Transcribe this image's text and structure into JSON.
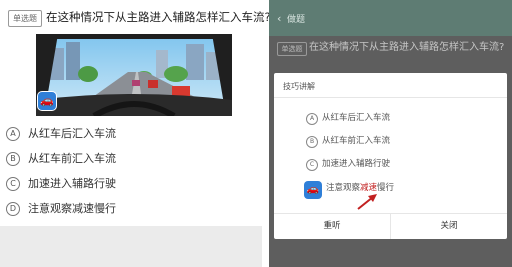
{
  "left": {
    "tag": "单选题",
    "question": "在这种情况下从主路进入辅路怎样汇入车流?",
    "options": [
      {
        "letter": "A",
        "label": "从红车后汇入车流"
      },
      {
        "letter": "B",
        "label": "从红车前汇入车流"
      },
      {
        "letter": "C",
        "label": "加速进入辅路行驶"
      },
      {
        "letter": "D",
        "label": "注意观察减速慢行"
      }
    ]
  },
  "right": {
    "header_title": "做题",
    "tag": "单选题",
    "question": "在这种情况下从主路进入辅路怎样汇入车流?",
    "dialog": {
      "title": "技巧讲解",
      "options": [
        {
          "letter": "A",
          "label": "从红车后汇入车流"
        },
        {
          "letter": "B",
          "label": "从红车前汇入车流"
        },
        {
          "letter": "C",
          "label": "加速进入辅路行驶"
        }
      ],
      "hint_prefix": "注意观察",
      "hint_highlight": "减速",
      "hint_suffix": "慢行",
      "btn_replay": "重听",
      "btn_close": "关闭"
    }
  },
  "colors": {
    "highlight": "#c22020",
    "app_icon": "#2f7fd8",
    "overlay": "#5e5e5e",
    "header": "#5e7c73"
  },
  "icons": {
    "app": "driving-school-app-icon",
    "back": "back-icon"
  }
}
